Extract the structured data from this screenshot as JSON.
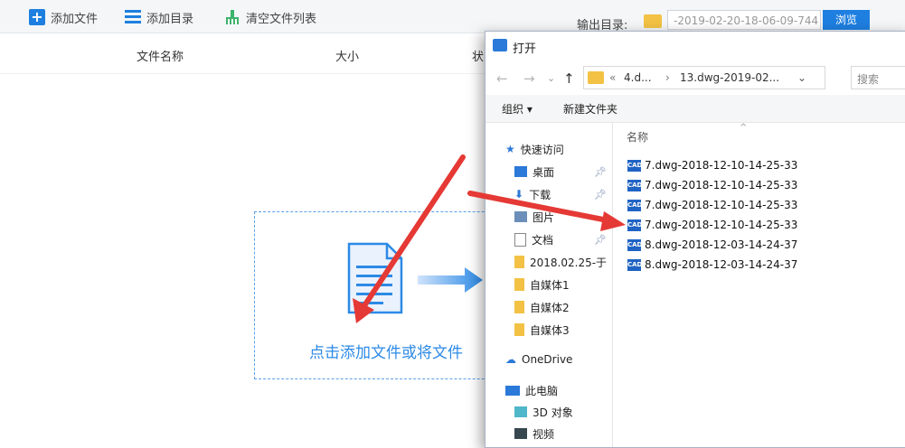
{
  "toolbar": {
    "add_file": "添加文件",
    "add_dir": "添加目录",
    "clear_list": "清空文件列表",
    "output_label": "输出目录:",
    "output_path": "-2019-02-20-18-06-09-744",
    "browse": "浏览"
  },
  "columns": {
    "name": "文件名称",
    "size": "大小",
    "status": "状"
  },
  "dropzone": {
    "text": "点击添加文件或将文件"
  },
  "dialog": {
    "title": "打开",
    "breadcrumbs": [
      "«",
      "4.d...",
      "›",
      "13.dwg-2019-02..."
    ],
    "search_placeholder": "搜索",
    "commands": {
      "organize": "组织 ▾",
      "new_folder": "新建文件夹"
    },
    "nav": {
      "quick_access": "快速访问",
      "items": [
        "桌面",
        "下载",
        "图片",
        "文档",
        "2018.02.25-于",
        "自媒体1",
        "自媒体2",
        "自媒体3"
      ],
      "onedrive": "OneDrive",
      "this_pc": "此电脑",
      "pc_items": [
        "3D 对象",
        "视频"
      ]
    },
    "file_header": "名称",
    "files": [
      "7.dwg-2018-12-10-14-25-33",
      "7.dwg-2018-12-10-14-25-33",
      "7.dwg-2018-12-10-14-25-33",
      "7.dwg-2018-12-10-14-25-33",
      "8.dwg-2018-12-03-14-24-37",
      "8.dwg-2018-12-03-14-24-37"
    ],
    "file_badge": "CAD"
  },
  "colors": {
    "accent": "#1e7fe0",
    "drop_text": "#2c8ae6",
    "arrow": "#e53935",
    "folder": "#f3c244"
  }
}
